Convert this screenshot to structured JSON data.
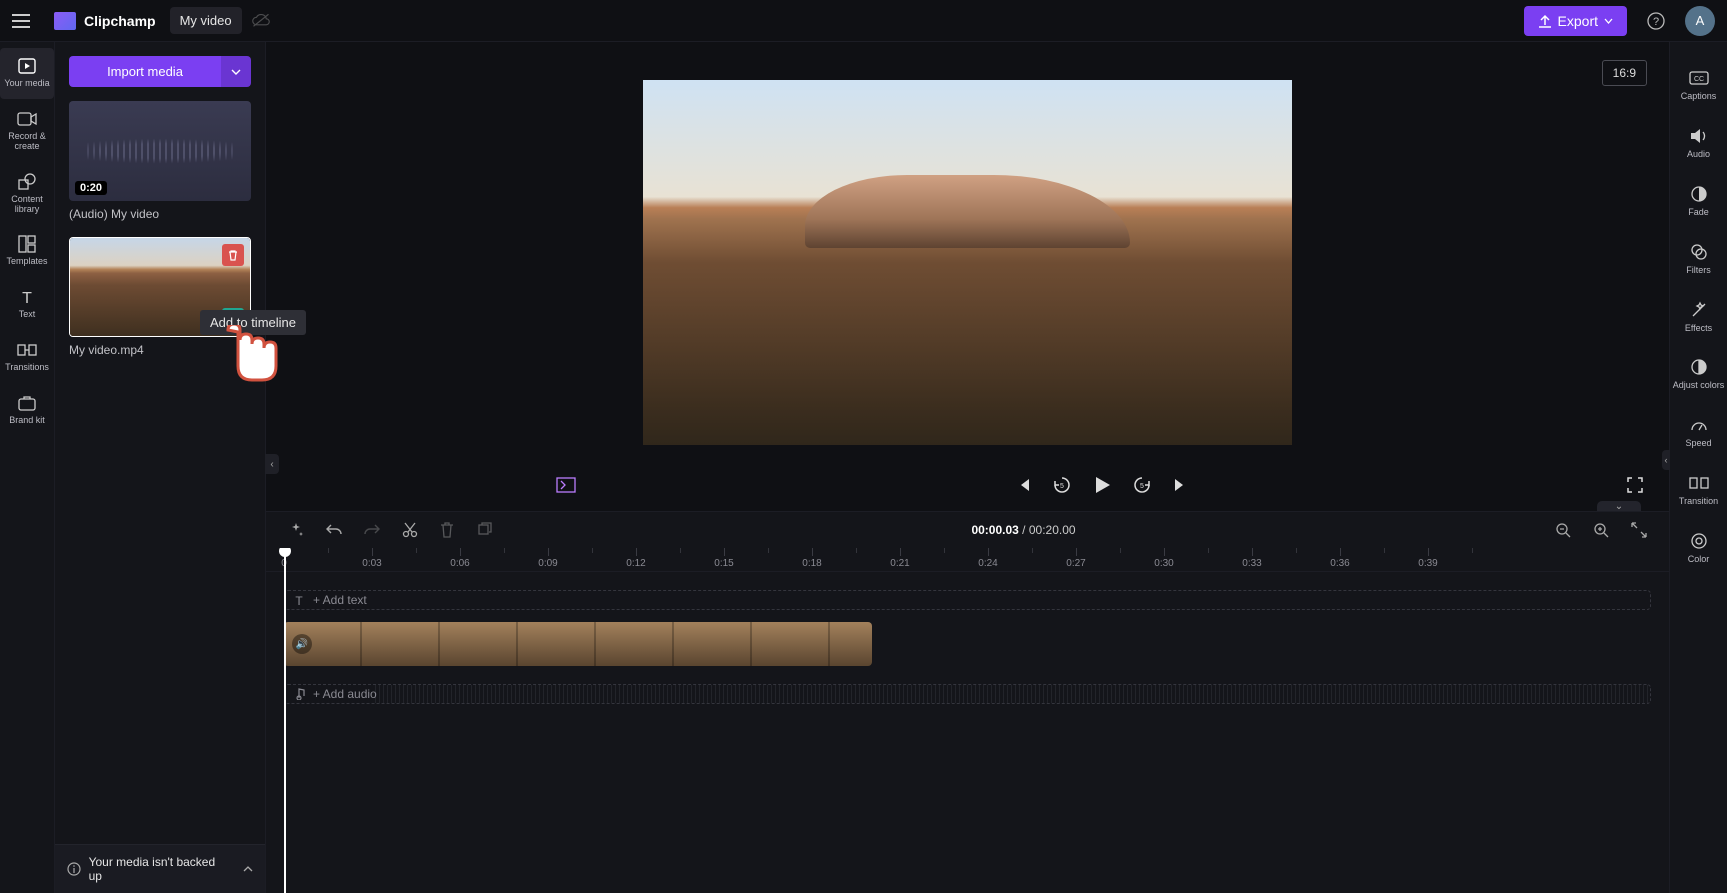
{
  "header": {
    "brand": "Clipchamp",
    "project_name": "My video",
    "export_label": "Export",
    "avatar_initial": "A"
  },
  "leftbar": {
    "items": [
      {
        "id": "your-media",
        "label": "Your media"
      },
      {
        "id": "record-create",
        "label": "Record & create"
      },
      {
        "id": "content-library",
        "label": "Content library"
      },
      {
        "id": "templates",
        "label": "Templates"
      },
      {
        "id": "text",
        "label": "Text"
      },
      {
        "id": "transitions",
        "label": "Transitions"
      },
      {
        "id": "brand-kit",
        "label": "Brand kit"
      }
    ]
  },
  "media_panel": {
    "import_label": "Import media",
    "audio_clip": {
      "duration": "0:20",
      "name": "(Audio) My video"
    },
    "video_clip": {
      "name": "My video.mp4"
    },
    "tooltip": "Add to timeline",
    "backup_msg": "Your media isn't backed up"
  },
  "stage": {
    "aspect_label": "16:9"
  },
  "player": {
    "current_time": "00:00.03",
    "separator": "/",
    "total_time": "00:20.00"
  },
  "timeline": {
    "ruler": [
      "0",
      "0:03",
      "0:06",
      "0:09",
      "0:12",
      "0:15",
      "0:18",
      "0:21",
      "0:24",
      "0:27",
      "0:30",
      "0:33",
      "0:36",
      "0:39"
    ],
    "add_text_label": "+ Add text",
    "add_audio_label": "+ Add audio"
  },
  "rightbar": {
    "items": [
      {
        "id": "captions",
        "label": "Captions"
      },
      {
        "id": "audio",
        "label": "Audio"
      },
      {
        "id": "fade",
        "label": "Fade"
      },
      {
        "id": "filters",
        "label": "Filters"
      },
      {
        "id": "effects",
        "label": "Effects"
      },
      {
        "id": "adjust-colors",
        "label": "Adjust colors"
      },
      {
        "id": "speed",
        "label": "Speed"
      },
      {
        "id": "transition",
        "label": "Transition"
      },
      {
        "id": "color",
        "label": "Color"
      }
    ]
  }
}
